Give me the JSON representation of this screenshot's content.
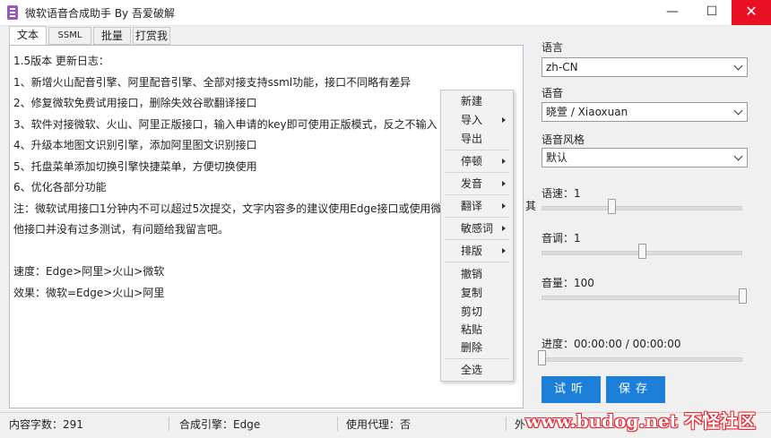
{
  "window": {
    "title": "微软语音合成助手 By 吾爱破解",
    "minimize": "—",
    "maximize": "☐",
    "close": "✕"
  },
  "tabs": [
    {
      "label": "文本",
      "active": true
    },
    {
      "label": "SSML",
      "active": false
    },
    {
      "label": "批量",
      "active": false
    },
    {
      "label": "打赏我",
      "active": false
    }
  ],
  "editor": {
    "lines": [
      "1.5版本 更新日志：",
      "1、新增火山配音引擎、阿里配音引擎、全部对接支持ssml功能，接口不同略有差异",
      "2、修复微软免费试用接口，删除失效谷歌翻译接口",
      "3、软件对接微软、火山、阿里正版接口，输入申请的key即可使用正版模式，反之不输入",
      "4、升级本地图文识别引擎，添加阿里图文识别接口",
      "5、托盘菜单添加切换引擎快捷菜单，方便切换使用",
      "6、优化各部分功能",
      "注：微软试用接口1分钟内不可以超过5次提交，文字内容多的建议使用Edge接口或使用微",
      "他接口并没有过多测试，有问题给我留言吧。",
      "",
      "速度：Edge>阿里>火山>微软",
      "效果：微软=Edge>火山>阿里"
    ],
    "overflow_char": "其"
  },
  "context_menu": {
    "items": [
      {
        "label": "新建",
        "submenu": false
      },
      {
        "label": "导入",
        "submenu": true
      },
      {
        "label": "导出",
        "submenu": false
      },
      {
        "label": "停顿",
        "submenu": true
      },
      {
        "label": "发音",
        "submenu": true
      },
      {
        "label": "翻译",
        "submenu": true
      },
      {
        "label": "敏感词",
        "submenu": true
      },
      {
        "label": "排版",
        "submenu": true
      },
      {
        "label": "撤销",
        "submenu": false
      },
      {
        "label": "复制",
        "submenu": false
      },
      {
        "label": "剪切",
        "submenu": false
      },
      {
        "label": "粘贴",
        "submenu": false
      },
      {
        "label": "删除",
        "submenu": false
      },
      {
        "label": "全选",
        "submenu": false
      }
    ]
  },
  "settings": {
    "language_label": "语言",
    "language_value": "zh-CN",
    "voice_label": "语音",
    "voice_value": "晓萱 / Xiaoxuan",
    "style_label": "语音风格",
    "style_value": "默认",
    "speed_label": "语速：1",
    "speed_fraction": 0.35,
    "pitch_label": "音调：1",
    "pitch_fraction": 0.5,
    "volume_label": "音量：100",
    "volume_fraction": 1.0,
    "progress_label": "进度：00:00:00 / 00:00:00",
    "progress_fraction": 0.0,
    "listen_button": "试听",
    "save_button": "保存"
  },
  "status": {
    "char_count": "内容字数：291",
    "engine": "合成引擎：Edge",
    "proxy": "使用代理：否",
    "partial": "外"
  },
  "watermark": "www.budog.net 不怪社区"
}
